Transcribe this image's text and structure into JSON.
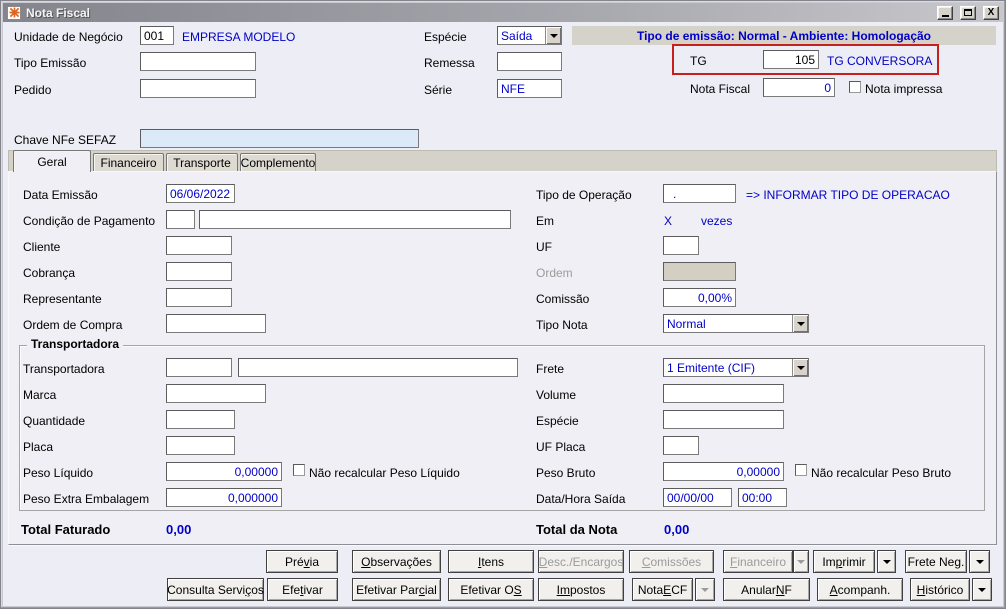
{
  "colors": {
    "value_blue": "#0000C8",
    "highlight_red": "#C81E1E",
    "banner_bg": "#D5D2C9"
  },
  "window": {
    "title": "Nota Fiscal"
  },
  "header": {
    "unidade": {
      "label": "Unidade de Negócio",
      "code": "001",
      "name": "EMPRESA MODELO"
    },
    "tipo_emissao": {
      "label": "Tipo Emissão",
      "value": ""
    },
    "pedido": {
      "label": "Pedido",
      "value": ""
    },
    "especie": {
      "label": "Espécie",
      "value": "Saída"
    },
    "remessa": {
      "label": "Remessa",
      "value": ""
    },
    "serie": {
      "label": "Série",
      "value": "NFE"
    },
    "banner": "Tipo de emissão: Normal - Ambiente: Homologação",
    "tg": {
      "label": "TG",
      "value": "105",
      "desc": "TG CONVERSORA"
    },
    "nota_fiscal": {
      "label": "Nota Fiscal",
      "value": "0",
      "check_label": "Nota impressa",
      "checked": false
    },
    "chave": {
      "label": "Chave NFe SEFAZ",
      "value": ""
    }
  },
  "tabs": [
    {
      "label": "Geral",
      "active": true
    },
    {
      "label": "Financeiro",
      "active": false
    },
    {
      "label": "Transporte",
      "active": false
    },
    {
      "label": "Complemento",
      "active": false
    }
  ],
  "geral": {
    "data_emissao": {
      "label": "Data Emissão",
      "value": "06/06/2022"
    },
    "condicao": {
      "label": "Condição de Pagamento",
      "code": "",
      "desc": ""
    },
    "cliente": {
      "label": "Cliente",
      "value": ""
    },
    "cobranca": {
      "label": "Cobrança",
      "value": ""
    },
    "representante": {
      "label": "Representante",
      "value": ""
    },
    "ordem_compra": {
      "label": "Ordem de Compra",
      "value": ""
    },
    "tipo_operacao": {
      "label": "Tipo de Operação",
      "value": ".",
      "hint": "=> INFORMAR TIPO DE OPERACAO"
    },
    "em": {
      "label": "Em",
      "x": "X",
      "vezes": "vezes"
    },
    "uf": {
      "label": "UF",
      "value": ""
    },
    "ordem": {
      "label": "Ordem",
      "value": "",
      "disabled": true
    },
    "comissao": {
      "label": "Comissão",
      "value": "0,00%"
    },
    "tipo_nota": {
      "label": "Tipo Nota",
      "value": "Normal"
    }
  },
  "transportadora": {
    "title": "Transportadora",
    "transportadora": {
      "label": "Transportadora",
      "code": "",
      "desc": ""
    },
    "marca": {
      "label": "Marca",
      "value": ""
    },
    "quantidade": {
      "label": "Quantidade",
      "value": ""
    },
    "placa": {
      "label": "Placa",
      "value": ""
    },
    "peso_liquido": {
      "label": "Peso Líquido",
      "value": "0,00000",
      "check_label": "Não recalcular Peso Líquido",
      "checked": false
    },
    "peso_extra": {
      "label": "Peso Extra Embalagem",
      "value": "0,000000"
    },
    "frete": {
      "label": "Frete",
      "value": "1 Emitente (CIF)"
    },
    "volume": {
      "label": "Volume",
      "value": ""
    },
    "especie": {
      "label": "Espécie",
      "value": ""
    },
    "uf_placa": {
      "label": "UF Placa",
      "value": ""
    },
    "peso_bruto": {
      "label": "Peso Bruto",
      "value": "0,00000",
      "check_label": "Não recalcular Peso Bruto",
      "checked": false
    },
    "data_hora_saida": {
      "label": "Data/Hora Saída",
      "date": "00/00/00",
      "time": "00:00"
    }
  },
  "totals": {
    "faturado": {
      "label": "Total Faturado",
      "value": "0,00"
    },
    "nota": {
      "label": "Total da Nota",
      "value": "0,00"
    }
  },
  "buttons": {
    "row1": [
      {
        "label": "Prévia",
        "u": 3
      },
      {
        "label": "Observações",
        "u": 0
      },
      {
        "label": "Itens",
        "u": 0
      },
      {
        "label": "Desc./Encargos",
        "u": 0,
        "disabled": true
      },
      {
        "label": "Comissões",
        "u": 0,
        "disabled": true
      },
      {
        "label": "Financeiro",
        "u": 0,
        "disabled": true
      },
      {
        "label": "Imprimir",
        "u": 2
      },
      {
        "label": "Frete Neg.",
        "u": 8
      }
    ],
    "row2": [
      {
        "label": "Consulta Serviços",
        "u": 14
      },
      {
        "label": "Efetivar",
        "u": 3
      },
      {
        "label": "Efetivar Parcial",
        "u": 12
      },
      {
        "label": "Efetivar OS",
        "u": 10
      },
      {
        "label": "Impostos",
        "u": 0,
        "ulen": 2
      },
      {
        "label": "Nota ECF",
        "u": 5
      },
      {
        "label": "Anular NF",
        "u": 7
      },
      {
        "label": "Acompanh.",
        "u": 0
      },
      {
        "label": "Histórico",
        "u": 0
      }
    ]
  }
}
